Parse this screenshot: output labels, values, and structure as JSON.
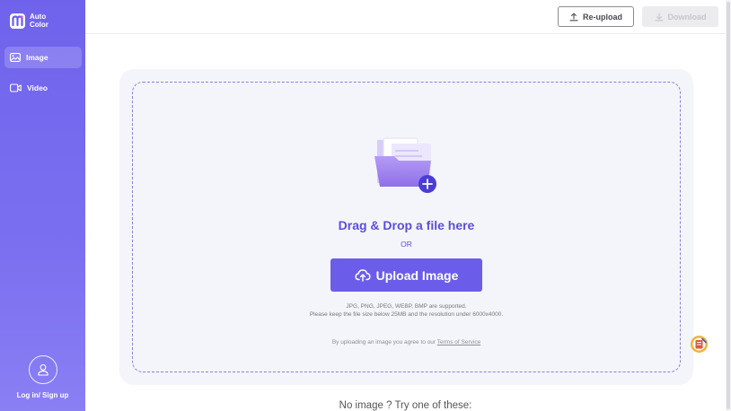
{
  "brand": {
    "line1": "Auto",
    "line2": "Color",
    "logo_icon": "m-logo-icon"
  },
  "sidebar": {
    "items": [
      {
        "label": "Image",
        "icon": "image-icon",
        "active": true
      },
      {
        "label": "Video",
        "icon": "video-icon",
        "active": false
      }
    ],
    "login_label": "Log in/ Sign up"
  },
  "toolbar": {
    "reupload_label": "Re-upload",
    "download_label": "Download",
    "download_enabled": false
  },
  "upload": {
    "drag_title": "Drag & Drop a file here",
    "or_text": "OR",
    "button_label": "Upload Image",
    "formats_text": "JPG, PNG, JPEG, WEBP, BMP are supported.",
    "limits_text": "Please keep the file size below 25MB and the resolution under 6000x4000.",
    "terms_prefix": "By uploading an image you agree to our ",
    "terms_link": "Terms of Service"
  },
  "samples": {
    "title": "No image ? Try one of these:"
  },
  "colors": {
    "accent": "#6b5de9",
    "sidebar_top": "#6f63ec",
    "sidebar_bottom": "#8a7ff3",
    "heading": "#5b4fd6"
  }
}
